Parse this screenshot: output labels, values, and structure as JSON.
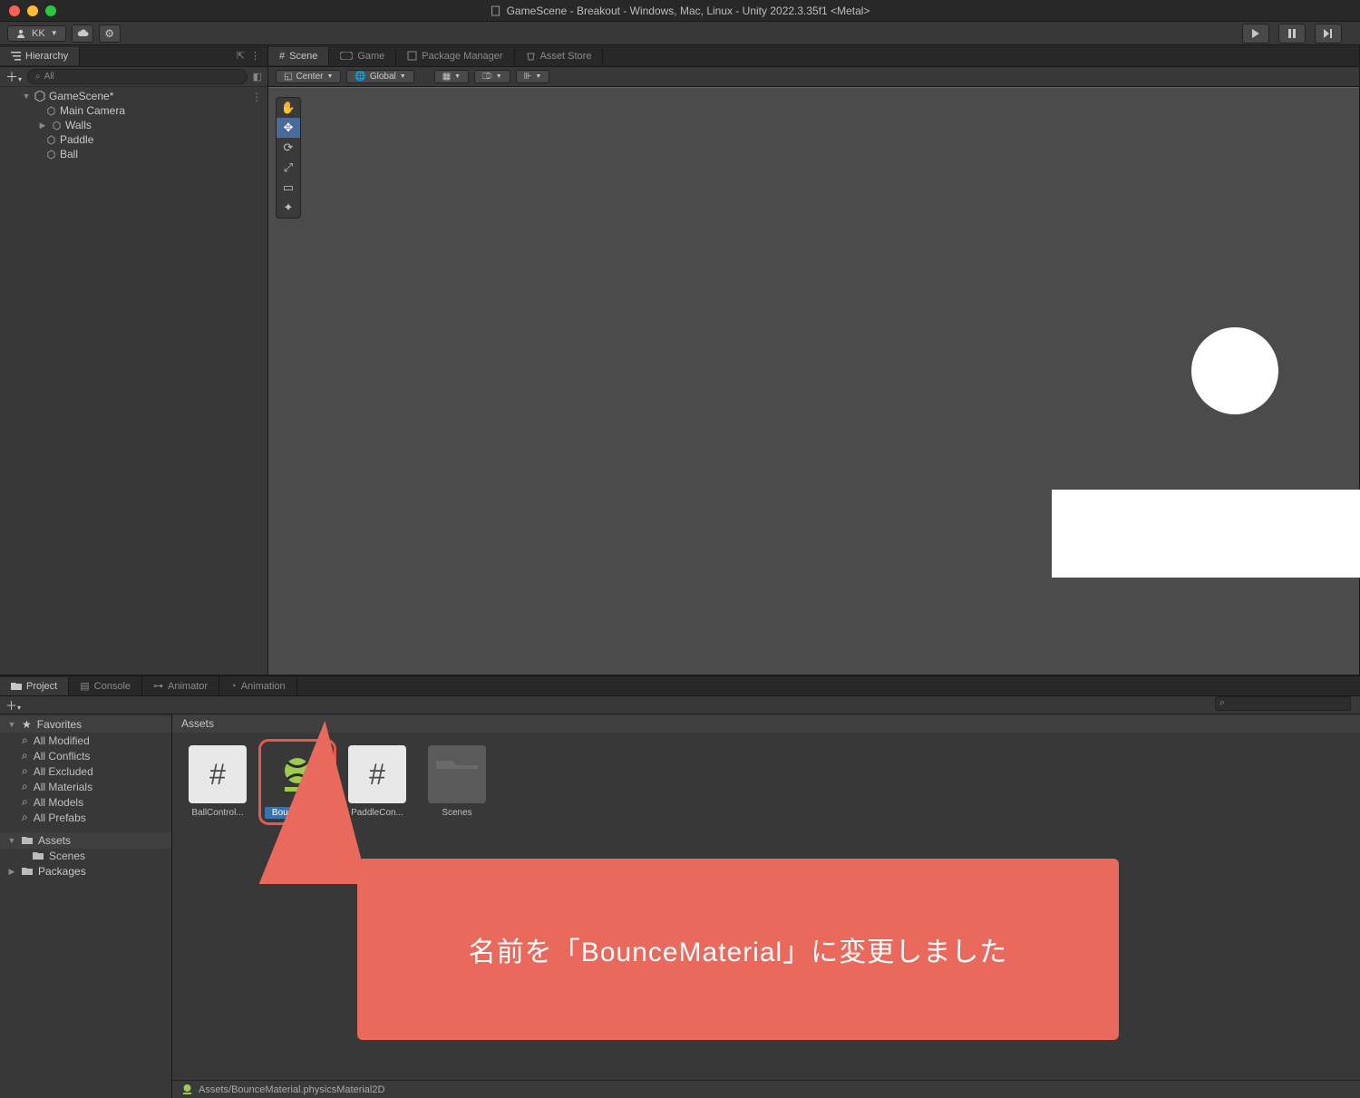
{
  "titlebar": {
    "title": "GameScene - Breakout - Windows, Mac, Linux - Unity 2022.3.35f1 <Metal>"
  },
  "toolbar": {
    "account_label": "KK",
    "play_tip": "Play",
    "pause_tip": "Pause",
    "step_tip": "Step"
  },
  "hierarchy": {
    "tab_label": "Hierarchy",
    "search_placeholder": "All",
    "scene_name": "GameScene*",
    "items": [
      "Main Camera",
      "Walls",
      "Paddle",
      "Ball"
    ]
  },
  "scene": {
    "tabs": [
      "Scene",
      "Game",
      "Package Manager",
      "Asset Store"
    ],
    "pivot": "Center",
    "space": "Global"
  },
  "project": {
    "tabs": [
      "Project",
      "Console",
      "Animator",
      "Animation"
    ],
    "favorites_label": "Favorites",
    "favorites": [
      "All Modified",
      "All Conflicts",
      "All Excluded",
      "All Materials",
      "All Models",
      "All Prefabs"
    ],
    "assets_label": "Assets",
    "assets_children": [
      "Scenes"
    ],
    "packages_label": "Packages",
    "breadcrumb": "Assets",
    "grid": [
      {
        "label": "BallControl...",
        "type": "script"
      },
      {
        "label": "BounceMa...",
        "type": "physmat",
        "selected": true,
        "highlight": true
      },
      {
        "label": "PaddleCon...",
        "type": "script"
      },
      {
        "label": "Scenes",
        "type": "folder"
      }
    ],
    "status_path": "Assets/BounceMaterial.physicsMaterial2D"
  },
  "callout": {
    "text": "名前を「BounceMaterial」に変更しました"
  }
}
